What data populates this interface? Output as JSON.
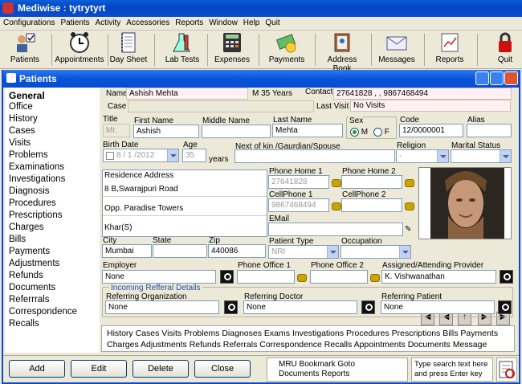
{
  "app": {
    "title": "Mediwise : tytrytyrt"
  },
  "menu": [
    "Configurations",
    "Patients",
    "Activity",
    "Accessories",
    "Reports",
    "Window",
    "Help",
    "Quit"
  ],
  "toolbar": [
    {
      "label": "Patients",
      "icon": "patients-icon"
    },
    {
      "label": "Appointments",
      "icon": "clock-icon"
    },
    {
      "label": "Day Sheet",
      "icon": "notebook-icon"
    },
    {
      "label": "Lab Tests",
      "icon": "flask-icon"
    },
    {
      "label": "Expenses",
      "icon": "calculator-icon"
    },
    {
      "label": "Payments",
      "icon": "money-icon"
    },
    {
      "label": "Address Book",
      "icon": "address-book-icon"
    },
    {
      "label": "Messages",
      "icon": "envelope-icon"
    },
    {
      "label": "Reports",
      "icon": "reports-icon"
    },
    {
      "label": "Quit",
      "icon": "lock-icon"
    }
  ],
  "panel": {
    "title": "Patients"
  },
  "nav": [
    "General",
    "Office",
    "History",
    "Cases",
    "Visits",
    "Problems",
    "Examinations",
    "Investigations",
    "Diagnosis",
    "Procedures",
    "Prescriptions",
    "Charges",
    "Bills",
    "Payments",
    "Adjustments",
    "Refunds",
    "Documents",
    "Referrrals",
    "Correspondence",
    "Recalls"
  ],
  "header": {
    "name_label": "Name",
    "name_value": "Ashish  Mehta",
    "agegender": "M 35 Years",
    "contact_label": "Contact",
    "contact_value": "27641828 , , 9867468494",
    "case_label": "Case",
    "lastvisit_label": "Last Visit",
    "lastvisit_value": "No Visits"
  },
  "form": {
    "title_label": "Title",
    "title_value": "Mr.",
    "firstname_label": "First Name",
    "firstname_value": "Ashish",
    "middlename_label": "Middle Name",
    "middlename_value": "",
    "lastname_label": "Last Name",
    "lastname_value": "Mehta",
    "sex_label": "Sex",
    "sex_m": "M",
    "sex_f": "F",
    "code_label": "Code",
    "code_value": "12/0000001",
    "alias_label": "Alias",
    "alias_value": "",
    "birthdate_label": "Birth Date",
    "birthdate_value": "8 / 1 /2012",
    "age_label": "Age",
    "age_value": "35",
    "years_label": "years",
    "nextofkin_label": "Next of kin /Gaurdian/Spouse",
    "nextofkin_value": "",
    "religion_label": "Religion",
    "religion_value": "-",
    "marital_label": "Marital Status",
    "marital_value": "",
    "address_label": "Residence Address",
    "address1": "8 B,Swarajpuri Road",
    "address2": "Opp. Paradise Towers",
    "address3": "Khar(S)",
    "phonehome1_label": "Phone Home 1",
    "phonehome1_value": "27641828",
    "phonehome2_label": "Phone Home 2",
    "phonehome2_value": "",
    "cell1_label": "CellPhone 1",
    "cell1_value": "9867468494",
    "cell2_label": "CellPhone 2",
    "cell2_value": "",
    "email_label": "EMail",
    "email_value": "",
    "city_label": "City",
    "city_value": "Mumbai",
    "state_label": "State",
    "state_value": "",
    "zip_label": "Zip",
    "zip_value": "440086",
    "patienttype_label": "Patient Type",
    "patienttype_value": "NRI",
    "occupation_label": "Occupation",
    "occupation_value": "",
    "employer_label": "Employer",
    "employer_value": "None",
    "office1_label": "Phone Office 1",
    "office1_value": "",
    "office2_label": "Phone Office 2",
    "office2_value": "",
    "provider_label": "Assigned/Attending Provider",
    "provider_value": "K. Vishwanathan",
    "referral_legend": "Incoming Refferal Details",
    "reforg_label": "Referring Organization",
    "reforg_value": "None",
    "refdoc_label": "Referring Doctor",
    "refdoc_value": "None",
    "refpat_label": "Referring Patient",
    "refpat_value": "None"
  },
  "photonav": [
    "◀",
    "◀",
    "↑",
    "▶",
    "▶"
  ],
  "links": "History  Cases  Visits  Problems  Diagnoses  Exams  Investigations  Procedures  Prescriptions  Bills  Payments  Charges  Adjustments  Refunds  Referrals  Correspondence  Recalls  Appointments  Documents  Message",
  "buttons": {
    "add": "Add",
    "edit": "Edit",
    "delete": "Delete",
    "close": "Close"
  },
  "bottommenu": "MRU  Bookmark  Goto  Documents  Reports",
  "searchhint": "Type search text here and press Enter key"
}
